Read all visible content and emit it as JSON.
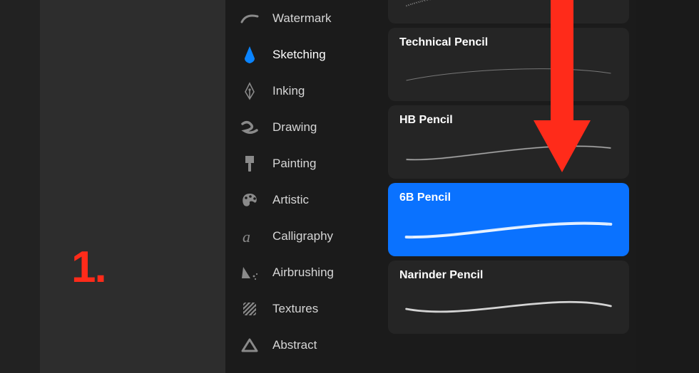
{
  "annotation": {
    "step_number": "1."
  },
  "categories": [
    {
      "id": "watermark",
      "label": "Watermark",
      "icon": "swoosh",
      "selected": false
    },
    {
      "id": "sketching",
      "label": "Sketching",
      "icon": "pencil-tip",
      "selected": true
    },
    {
      "id": "inking",
      "label": "Inking",
      "icon": "nib",
      "selected": false
    },
    {
      "id": "drawing",
      "label": "Drawing",
      "icon": "squiggle",
      "selected": false
    },
    {
      "id": "painting",
      "label": "Painting",
      "icon": "paintbrush",
      "selected": false
    },
    {
      "id": "artistic",
      "label": "Artistic",
      "icon": "palette",
      "selected": false
    },
    {
      "id": "calligraphy",
      "label": "Calligraphy",
      "icon": "script-a",
      "selected": false
    },
    {
      "id": "airbrushing",
      "label": "Airbrushing",
      "icon": "airbrush",
      "selected": false
    },
    {
      "id": "textures",
      "label": "Textures",
      "icon": "hatch",
      "selected": false
    },
    {
      "id": "abstract",
      "label": "Abstract",
      "icon": "triangle",
      "selected": false
    }
  ],
  "brushes": [
    {
      "id": "top-cut",
      "name": "",
      "selected": false
    },
    {
      "id": "technical",
      "name": "Technical Pencil",
      "selected": false
    },
    {
      "id": "hb",
      "name": "HB Pencil",
      "selected": false
    },
    {
      "id": "6b",
      "name": "6B Pencil",
      "selected": true
    },
    {
      "id": "narinder",
      "name": "Narinder Pencil",
      "selected": false
    }
  ],
  "colors": {
    "accent": "#0a72ff",
    "annotation": "#ff2b1a"
  }
}
